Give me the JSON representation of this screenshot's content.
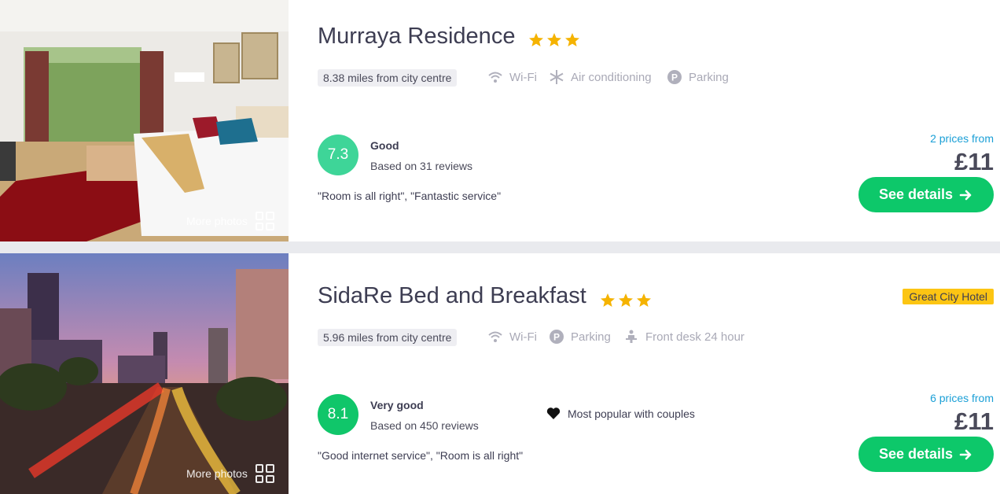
{
  "hotels": [
    {
      "name": "Murraya Residence",
      "star_count": 3,
      "more_photos": "More photos",
      "distance": "8.38 miles from city centre",
      "amenities": [
        {
          "label": "Wi-Fi",
          "icon": "wifi-icon"
        },
        {
          "label": "Air conditioning",
          "icon": "snowflake-icon"
        },
        {
          "label": "Parking",
          "icon": "parking-icon"
        }
      ],
      "score": "7.3",
      "score_color": "#3ed598",
      "rating_word": "Good",
      "reviews": "Based on 31 reviews",
      "quotes": "\"Room is all right\", \"Fantastic service\"",
      "prices_from": "2 prices from",
      "price": "£11",
      "cta": "See details"
    },
    {
      "name": "SidaRe Bed and Breakfast",
      "star_count": 3,
      "more_photos": "More photos",
      "badge": "Great City Hotel",
      "distance": "5.96 miles from city centre",
      "amenities": [
        {
          "label": "Wi-Fi",
          "icon": "wifi-icon"
        },
        {
          "label": "Parking",
          "icon": "parking-icon"
        },
        {
          "label": "Front desk 24 hour",
          "icon": "front-desk-icon"
        }
      ],
      "score": "8.1",
      "score_color": "#10c66a",
      "rating_word": "Very good",
      "reviews": "Based on 450 reviews",
      "popular": "Most popular with couples",
      "quotes": "\"Good internet service\", \"Room is all right\"",
      "prices_from": "6 prices from",
      "price": "£11",
      "cta": "See details"
    }
  ],
  "colors": {
    "star": "#f5b301",
    "cta": "#0dc86a",
    "price_link": "#1a9fd6",
    "badge": "#fcc513"
  }
}
